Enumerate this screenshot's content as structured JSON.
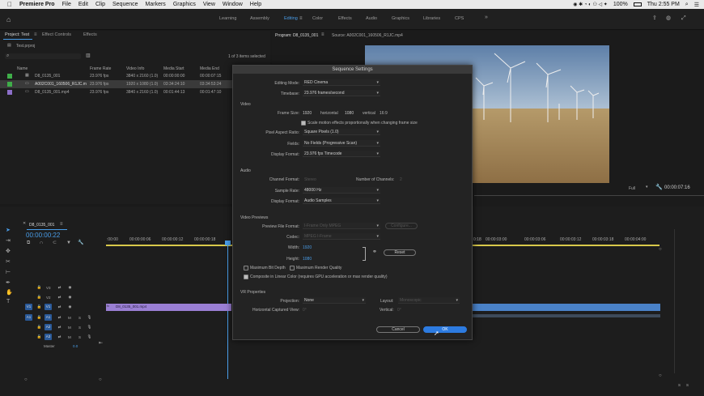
{
  "menubar": {
    "app": "Premiere Pro",
    "items": [
      "File",
      "Edit",
      "Clip",
      "Sequence",
      "Markers",
      "Graphics",
      "View",
      "Window",
      "Help"
    ],
    "battery": "100%",
    "clock": "Thu 2:55 PM"
  },
  "workspaces": [
    "Learning",
    "Assembly",
    "Editing",
    "Color",
    "Effects",
    "Audio",
    "Graphics",
    "Libraries",
    "CPS"
  ],
  "project_panel": {
    "tabs": [
      "Project: Test",
      "Effect Controls",
      "Effects"
    ],
    "file": "Test.prproj",
    "selection": "1 of 3 items selected",
    "columns": [
      "Name",
      "Frame Rate",
      "Video Info",
      "Media Start",
      "Media End"
    ],
    "items": [
      {
        "name": "D8_0135_001",
        "fps": "23.976 fps",
        "info": "3840 x 2160 (1.0)",
        "start": "00:00:00:00",
        "end": "00:00:07:15",
        "color": "#3fae49"
      },
      {
        "name": "A002C001_160506_R1JC.m",
        "fps": "23.976 fps",
        "info": "1920 x 1080 (1.0)",
        "start": "03:34:24:10",
        "end": "03:34:53:24",
        "color": "#3fae49"
      },
      {
        "name": "D8_0135_001.mp4",
        "fps": "23.976 fps",
        "info": "3840 x 2160 (1.0)",
        "start": "00:01:44:13",
        "end": "00:01:47:10",
        "color": "#8c6fc9"
      }
    ]
  },
  "program_monitor": {
    "tab": "Program: D8_0135_001",
    "source_tab": "Source: A002C001_160506_R1JC.mp4",
    "zoom": "Full",
    "timecode": "00:00:07:16"
  },
  "timeline": {
    "sequence": "D8_0135_001",
    "timecode": "00:00:00:22",
    "ruler_left": [
      ":00:00",
      "00:00:00:06",
      "00:00:00:12",
      "00:00:00:18"
    ],
    "ruler_right": [
      "0:18",
      "00:00:03:00",
      "00:00:03:06",
      "00:00:03:12",
      "00:00:03:18",
      "00:00:04:00"
    ],
    "tracks": [
      "V3",
      "V2",
      "V1",
      "A1",
      "A2",
      "A3"
    ],
    "src_v": "V1",
    "src_a": "A1",
    "master": "Master",
    "master_val": "0.0",
    "clip": "D8_0135_001.mp4",
    "m_label": "M",
    "s_label": "S"
  },
  "dialog": {
    "title": "Sequence Settings",
    "editing_mode_label": "Editing Mode:",
    "editing_mode": "RED Cinema",
    "timebase_label": "Timebase:",
    "timebase": "23.976 frames/second",
    "video_heading": "Video",
    "frame_size_label": "Frame Size:",
    "frame_w": "1920",
    "horizontal_label": "horizontal",
    "frame_h": "1080",
    "vertical_label": "vertical",
    "aspect": "16:9",
    "scale_label": "Scale motion effects proportionally when changing frame size",
    "par_label": "Pixel Aspect Ratio:",
    "par": "Square Pixels (1.0)",
    "fields_label": "Fields:",
    "fields": "No Fields (Progressive Scan)",
    "display_format_label": "Display Format:",
    "display_format": "23.976 fps Timecode",
    "audio_heading": "Audio",
    "channel_format_label": "Channel Format:",
    "channel_format": "Stereo",
    "num_channels_label": "Number of Channels:",
    "num_channels": "2",
    "sample_rate_label": "Sample Rate:",
    "sample_rate": "48000 Hz",
    "audio_display_label": "Display Format:",
    "audio_display": "Audio Samples",
    "previews_heading": "Video Previews",
    "preview_format_label": "Preview File Format:",
    "preview_format": "I-Frame Only MPEG",
    "configure": "Configure...",
    "codec_label": "Codec:",
    "codec": "MPEG I-Frame",
    "width_label": "Width:",
    "width": "1920",
    "height_label": "Height:",
    "height": "1080",
    "reset": "Reset",
    "max_bit_depth": "Maximum Bit Depth",
    "max_render": "Maximum Render Quality",
    "composite": "Composite in Linear Color (requires GPU acceleration or max render quality)",
    "vr_heading": "VR Properties",
    "projection_label": "Projection:",
    "projection": "None",
    "layout_label": "Layout:",
    "layout": "Monoscopic",
    "hcv_label": "Horizontal Captured View:",
    "hcv": "0°",
    "vertical2_label": "Vertical:",
    "vertical2": "0°",
    "cancel": "Cancel",
    "ok": "OK"
  }
}
